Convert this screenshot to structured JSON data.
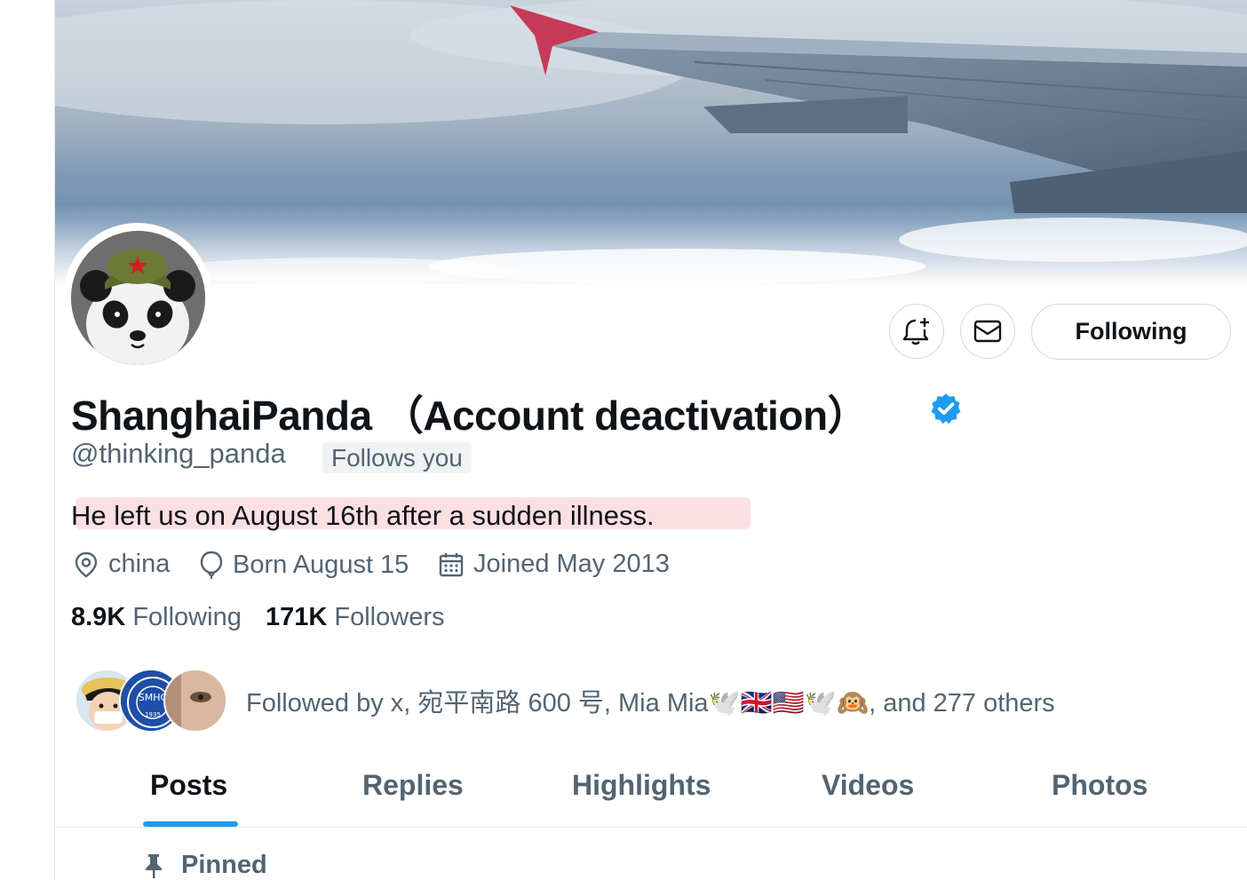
{
  "profile": {
    "display_name": "ShanghaiPanda （Account deactivation）",
    "handle": "@thinking_panda",
    "follows_you_badge": "Follows you",
    "bio": "He left us on August 16th after a sudden illness.",
    "location": "china",
    "birthday": "Born August 15",
    "joined": "Joined May 2013",
    "following_count": "8.9K",
    "following_label": "Following",
    "followers_count": "171K",
    "followers_label": "Followers",
    "followed_by_text": "Followed by x, 宛平南路 600 号, Mia Mia🕊️🇬🇧🇺🇸🕊️🙉, and 277 others",
    "verified_color": "#1d9bf0"
  },
  "actions": {
    "follow_button_label": "Following",
    "notify_icon": "bell-plus-icon",
    "message_icon": "envelope-icon"
  },
  "tabs": [
    {
      "label": "Posts",
      "active": true
    },
    {
      "label": "Replies",
      "active": false
    },
    {
      "label": "Highlights",
      "active": false
    },
    {
      "label": "Videos",
      "active": false
    },
    {
      "label": "Photos",
      "active": false
    }
  ],
  "pinned": {
    "label": "Pinned",
    "icon": "pin-icon"
  },
  "colors": {
    "accent": "#1d9bf0",
    "text_primary": "#0f1419",
    "text_secondary": "#536471",
    "bio_highlight": "#fbd9dd"
  }
}
